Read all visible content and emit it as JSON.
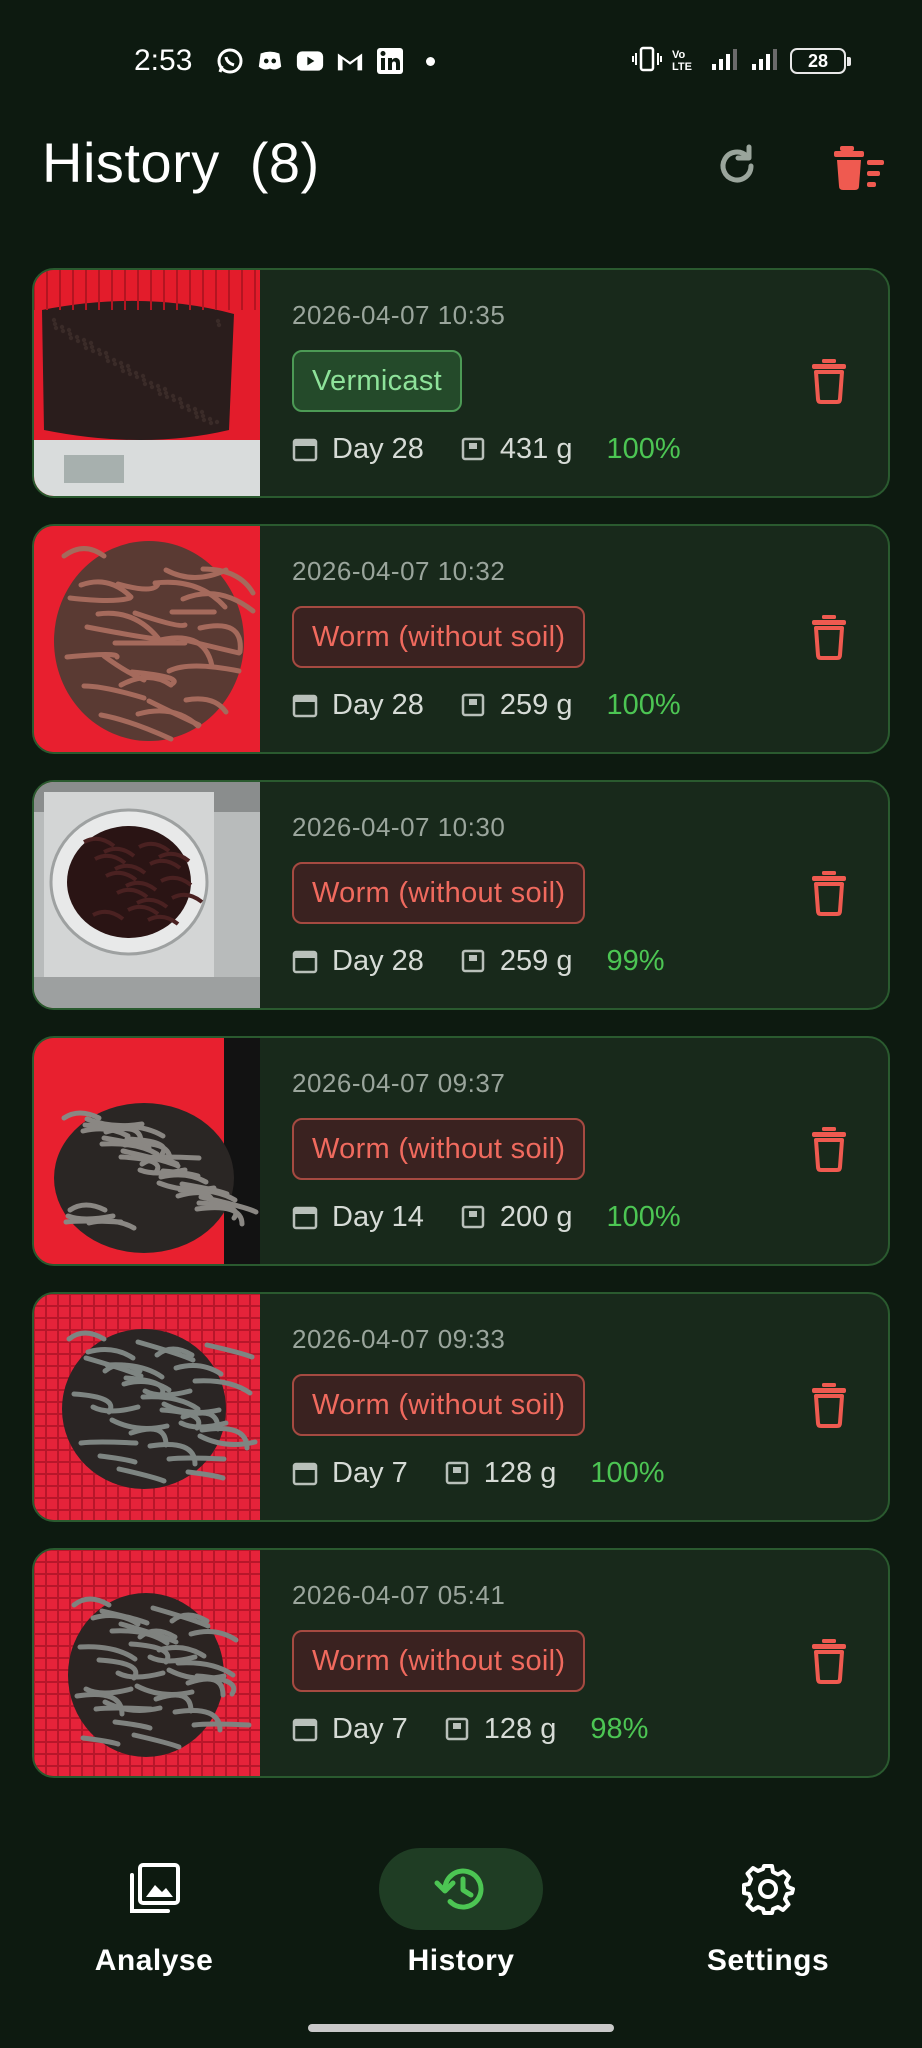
{
  "status_bar": {
    "time": "2:53",
    "notification_icons": [
      "whatsapp-icon",
      "discord-icon",
      "youtube-icon",
      "gmail-icon",
      "linkedin-icon"
    ],
    "network_label": "Vo LTE",
    "battery": "28"
  },
  "header": {
    "title": "History",
    "count": "(8)",
    "refresh_icon": "refresh-icon",
    "clear_icon": "clear-all-icon"
  },
  "colors": {
    "background": "#0d1a10",
    "card": "#18291b",
    "card_border": "#2a5a2f",
    "vermicast": "#8ee29a",
    "worm": "#f06a5e",
    "confidence": "#4cc553",
    "delete": "#ef5a50"
  },
  "history": [
    {
      "timestamp": "2026-04-07  10:35",
      "label": "Vermicast",
      "kind": "vermicast",
      "day": "Day 28",
      "weight": "431 g",
      "confidence": "100%"
    },
    {
      "timestamp": "2026-04-07  10:32",
      "label": "Worm (without soil)",
      "kind": "worm",
      "day": "Day 28",
      "weight": "259 g",
      "confidence": "100%"
    },
    {
      "timestamp": "2026-04-07  10:30",
      "label": "Worm (without soil)",
      "kind": "worm",
      "day": "Day 28",
      "weight": "259 g",
      "confidence": "99%"
    },
    {
      "timestamp": "2026-04-07  09:37",
      "label": "Worm (without soil)",
      "kind": "worm",
      "day": "Day 14",
      "weight": "200 g",
      "confidence": "100%"
    },
    {
      "timestamp": "2026-04-07  09:33",
      "label": "Worm (without soil)",
      "kind": "worm",
      "day": "Day 7",
      "weight": "128 g",
      "confidence": "100%"
    },
    {
      "timestamp": "2026-04-07  05:41",
      "label": "Worm (without soil)",
      "kind": "worm",
      "day": "Day 7",
      "weight": "128 g",
      "confidence": "98%"
    }
  ],
  "nav": {
    "analyse": "Analyse",
    "history": "History",
    "settings": "Settings",
    "active": "history"
  }
}
